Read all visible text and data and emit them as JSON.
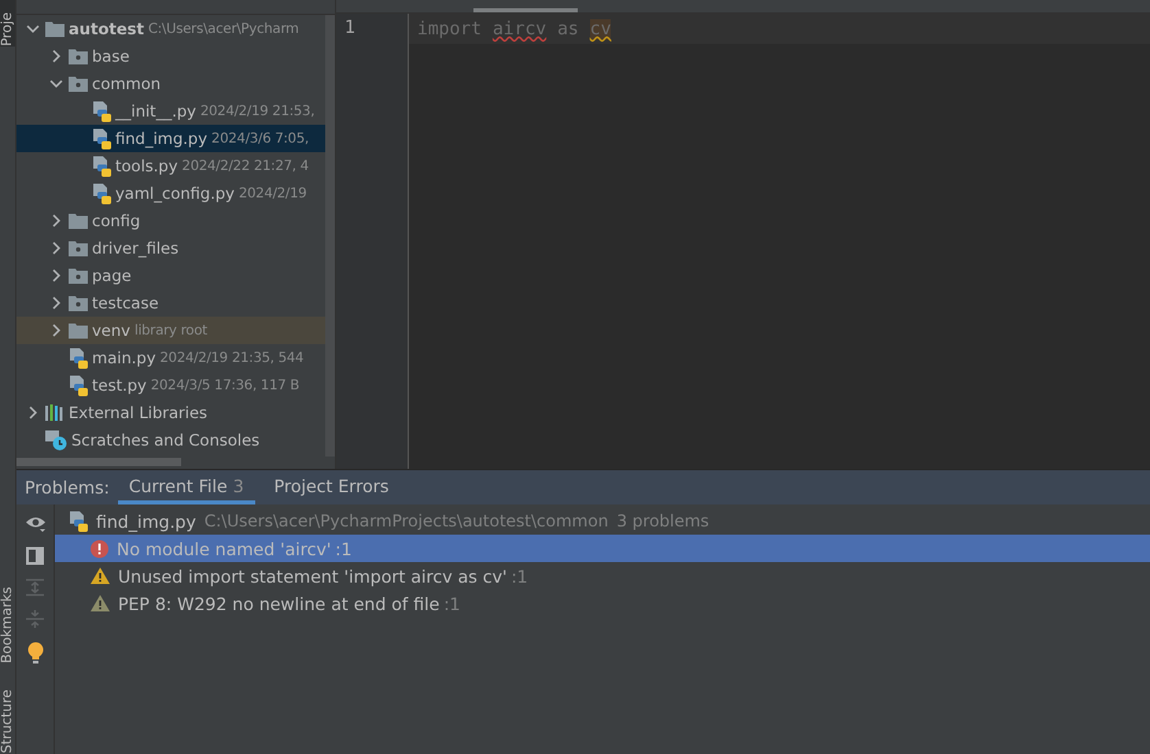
{
  "side_stripe": {
    "top_label": "Proje",
    "bottom_labels": [
      "Bookmarks",
      "Structure"
    ]
  },
  "project_tree": [
    {
      "name": "autotest",
      "detail": "C:\\Users\\acer\\Pycharm",
      "kind": "folder",
      "expanded": true,
      "selected": false,
      "children": [
        {
          "name": "base",
          "kind": "module_folder",
          "expanded": false,
          "selected": false
        },
        {
          "name": "common",
          "kind": "module_folder",
          "expanded": true,
          "selected": false,
          "children": [
            {
              "name": "__init__.py",
              "detail": "2024/2/19 21:53,",
              "kind": "python_file",
              "selected": false
            },
            {
              "name": "find_img.py",
              "detail": "2024/3/6 7:05,",
              "kind": "python_file",
              "selected": true
            },
            {
              "name": "tools.py",
              "detail": "2024/2/22 21:27, 4",
              "kind": "python_file",
              "selected": false
            },
            {
              "name": "yaml_config.py",
              "detail": "2024/2/19",
              "kind": "python_file",
              "selected": false
            }
          ]
        },
        {
          "name": "config",
          "kind": "folder",
          "expanded": false,
          "selected": false
        },
        {
          "name": "driver_files",
          "kind": "module_folder",
          "expanded": false,
          "selected": false
        },
        {
          "name": "page",
          "kind": "module_folder",
          "expanded": false,
          "selected": false
        },
        {
          "name": "testcase",
          "kind": "module_folder",
          "expanded": false,
          "selected": false
        },
        {
          "name": "venv",
          "detail": "library root",
          "kind": "library_root",
          "expanded": false,
          "selected": false
        },
        {
          "name": "main.py",
          "detail": "2024/2/19 21:35, 544",
          "kind": "python_file",
          "selected": false
        },
        {
          "name": "test.py",
          "detail": "2024/3/5 17:36, 117 B",
          "kind": "python_file",
          "selected": false
        }
      ]
    },
    {
      "name": "External Libraries",
      "kind": "libraries",
      "expanded": false,
      "selected": false
    },
    {
      "name": "Scratches and Consoles",
      "kind": "scratches",
      "selected": false
    }
  ],
  "editor": {
    "line_numbers": [
      "1"
    ],
    "tokens": [
      {
        "text": "import",
        "kind": "keyword"
      },
      {
        "text": "aircv",
        "kind": "error"
      },
      {
        "text": "as",
        "kind": "keyword"
      },
      {
        "text": "cv",
        "kind": "warning"
      }
    ]
  },
  "problems": {
    "title": "Problems:",
    "tabs": [
      {
        "label": "Current File",
        "count": "3",
        "selected": true
      },
      {
        "label": "Project Errors",
        "selected": false
      }
    ],
    "file": {
      "name": "find_img.py",
      "path": "C:\\Users\\acer\\PycharmProjects\\autotest\\common",
      "count": "3 problems"
    },
    "items": [
      {
        "message": "No module named 'aircv'",
        "line": ":1",
        "kind": "error",
        "selected": true
      },
      {
        "message": "Unused import statement 'import aircv as cv'",
        "line": ":1",
        "kind": "warning",
        "selected": false
      },
      {
        "message": "PEP 8: W292 no newline at end of file",
        "line": ":1",
        "kind": "weak_warning",
        "selected": false
      }
    ]
  }
}
